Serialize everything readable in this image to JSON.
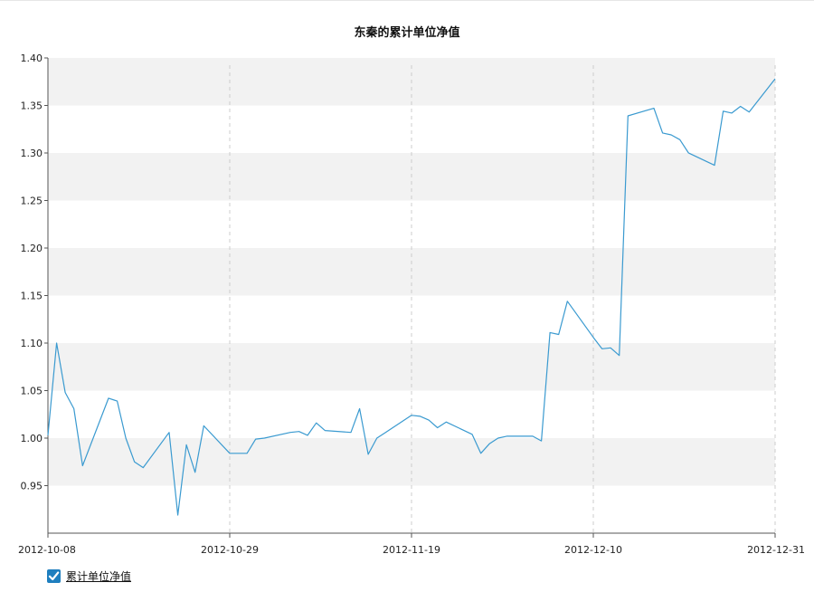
{
  "chart_data": {
    "type": "line",
    "title": "东秦的累计单位净值",
    "xlabel": "",
    "ylabel": "",
    "x_ticks": [
      "2012-10-08",
      "2012-10-29",
      "2012-11-19",
      "2012-12-10",
      "2012-12-31"
    ],
    "y_ticks": [
      "0.95",
      "1.00",
      "1.05",
      "1.10",
      "1.15",
      "1.20",
      "1.25",
      "1.30",
      "1.35",
      "1.40"
    ],
    "xlim": [
      "2012-10-08",
      "2012-12-31"
    ],
    "ylim": [
      0.9,
      1.4
    ],
    "grid": "horizontal bands, dashed vertical lines",
    "legend_position": "bottom-left",
    "series": [
      {
        "name": "累计单位净值",
        "color": "#3a9ad0",
        "points": [
          [
            "2012-10-08",
            1.003
          ],
          [
            "2012-10-09",
            1.1
          ],
          [
            "2012-10-10",
            1.048
          ],
          [
            "2012-10-11",
            1.031
          ],
          [
            "2012-10-12",
            0.971
          ],
          [
            "2012-10-15",
            1.042
          ],
          [
            "2012-10-16",
            1.039
          ],
          [
            "2012-10-17",
            1.0
          ],
          [
            "2012-10-18",
            0.975
          ],
          [
            "2012-10-19",
            0.969
          ],
          [
            "2012-10-22",
            1.006
          ],
          [
            "2012-10-23",
            0.919
          ],
          [
            "2012-10-24",
            0.993
          ],
          [
            "2012-10-25",
            0.964
          ],
          [
            "2012-10-26",
            1.013
          ],
          [
            "2012-10-29",
            0.984
          ],
          [
            "2012-10-30",
            0.984
          ],
          [
            "2012-10-31",
            0.984
          ],
          [
            "2012-11-01",
            0.999
          ],
          [
            "2012-11-02",
            1.0
          ],
          [
            "2012-11-05",
            1.006
          ],
          [
            "2012-11-06",
            1.007
          ],
          [
            "2012-11-07",
            1.003
          ],
          [
            "2012-11-08",
            1.016
          ],
          [
            "2012-11-09",
            1.008
          ],
          [
            "2012-11-12",
            1.006
          ],
          [
            "2012-11-13",
            1.031
          ],
          [
            "2012-11-14",
            0.983
          ],
          [
            "2012-11-15",
            1.0
          ],
          [
            "2012-11-16",
            1.006
          ],
          [
            "2012-11-19",
            1.024
          ],
          [
            "2012-11-20",
            1.023
          ],
          [
            "2012-11-21",
            1.019
          ],
          [
            "2012-11-22",
            1.011
          ],
          [
            "2012-11-23",
            1.017
          ],
          [
            "2012-11-26",
            1.004
          ],
          [
            "2012-11-27",
            0.984
          ],
          [
            "2012-11-28",
            0.994
          ],
          [
            "2012-11-29",
            1.0
          ],
          [
            "2012-11-30",
            1.002
          ],
          [
            "2012-12-03",
            1.002
          ],
          [
            "2012-12-04",
            0.997
          ],
          [
            "2012-12-05",
            1.111
          ],
          [
            "2012-12-06",
            1.109
          ],
          [
            "2012-12-07",
            1.144
          ],
          [
            "2012-12-10",
            1.106
          ],
          [
            "2012-12-11",
            1.094
          ],
          [
            "2012-12-12",
            1.095
          ],
          [
            "2012-12-13",
            1.087
          ],
          [
            "2012-12-14",
            1.339
          ],
          [
            "2012-12-17",
            1.347
          ],
          [
            "2012-12-18",
            1.321
          ],
          [
            "2012-12-19",
            1.319
          ],
          [
            "2012-12-20",
            1.314
          ],
          [
            "2012-12-21",
            1.3
          ],
          [
            "2012-12-24",
            1.287
          ],
          [
            "2012-12-25",
            1.344
          ],
          [
            "2012-12-26",
            1.342
          ],
          [
            "2012-12-27",
            1.349
          ],
          [
            "2012-12-28",
            1.343
          ],
          [
            "2012-12-31",
            1.378
          ]
        ]
      }
    ]
  },
  "legend": {
    "label": "累计单位净值",
    "checked": true,
    "check_icon": "checkmark-icon"
  }
}
